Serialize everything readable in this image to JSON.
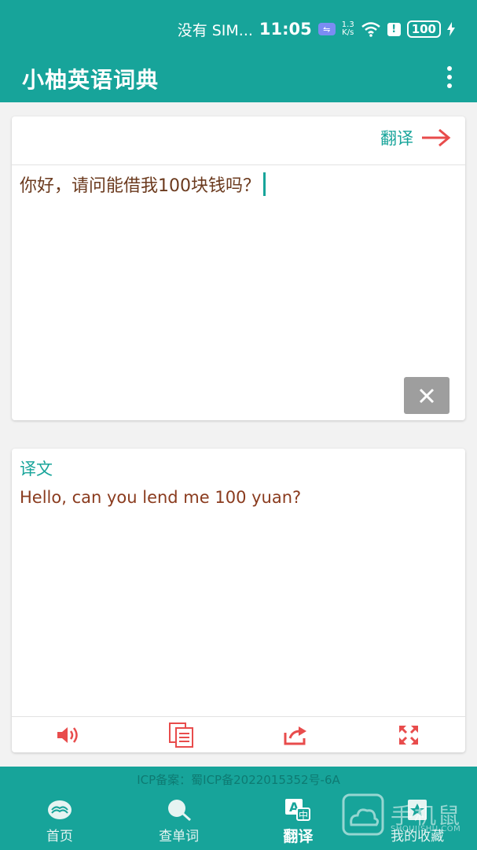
{
  "status_bar": {
    "carrier": "没有 SIM...",
    "time": "11:05",
    "speed_value": "1.3",
    "speed_unit": "K/s",
    "battery": "100"
  },
  "app_bar": {
    "title": "小柚英语词典"
  },
  "input": {
    "translate_label": "翻译",
    "source_text": "你好，请问能借我100块钱吗？"
  },
  "result": {
    "title": "译文",
    "text": "Hello, can you lend me 100 yuan?"
  },
  "footer": {
    "icp": "ICP备案：蜀ICP备2022015352号-6A"
  },
  "nav": {
    "items": [
      {
        "label": "首页",
        "icon": "home-book-icon"
      },
      {
        "label": "查单词",
        "icon": "search-icon"
      },
      {
        "label": "翻译",
        "icon": "translate-icon",
        "active": true
      },
      {
        "label": "我的收藏",
        "icon": "favorites-icon"
      }
    ]
  },
  "watermark": {
    "text": "手机鼠",
    "url": "SHOUJISHU.COM"
  },
  "colors": {
    "primary": "#17a49a",
    "accent_red": "#e84c4c",
    "text_brown": "#6b3a1e",
    "clear_grey": "#9e9e9e"
  }
}
